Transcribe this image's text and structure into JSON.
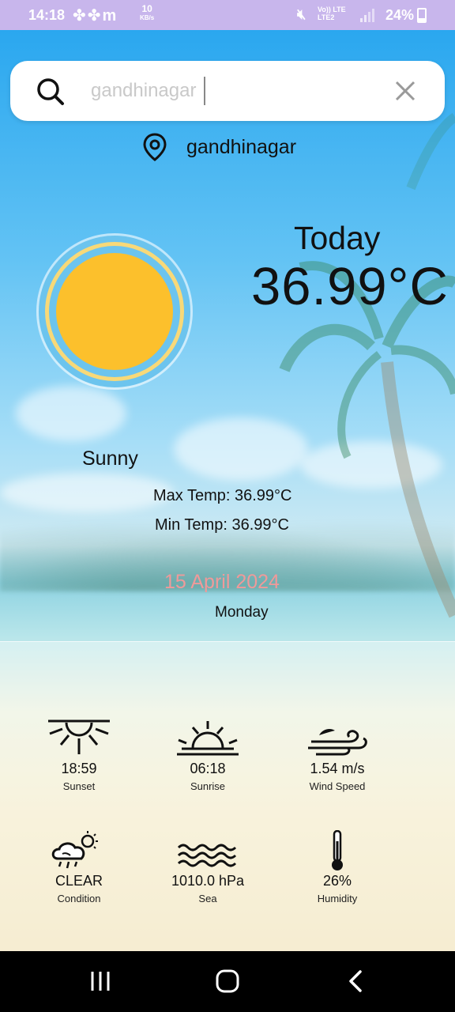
{
  "status_bar": {
    "time": "14:18",
    "data_speed": "10",
    "data_speed_unit": "KB/s",
    "network_1": "Vo)) LTE",
    "network_2": "LTE",
    "network_3": "LTE2",
    "battery": "24%"
  },
  "search": {
    "query": "gandhinagar",
    "placeholder": "gandhinagar"
  },
  "location": {
    "city": "gandhinagar"
  },
  "current": {
    "today_label": "Today",
    "temperature": "36.99°C",
    "condition": "Sunny",
    "max_temp": "Max Temp: 36.99°C",
    "min_temp": "Min Temp: 36.99°C",
    "date": "15 April 2024",
    "day": "Monday"
  },
  "stats": [
    {
      "value": "18:59",
      "label": "Sunset",
      "icon": "sunset-icon"
    },
    {
      "value": "06:18",
      "label": "Sunrise",
      "icon": "sunrise-icon"
    },
    {
      "value": "1.54 m/s",
      "label": "Wind Speed",
      "icon": "wind-icon"
    },
    {
      "value": "CLEAR",
      "label": "Condition",
      "icon": "weather-condition-icon"
    },
    {
      "value": "1010.0 hPa",
      "label": "Sea",
      "icon": "sea-waves-icon"
    },
    {
      "value": "26%",
      "label": "Humidity",
      "icon": "thermometer-icon"
    }
  ],
  "colors": {
    "sun": "#fcc02c",
    "sun_ring_blue": "#6cc4ee",
    "sun_ring_yellow": "#f8d978",
    "date_text": "#ef9a9a",
    "status_bar": "#c8b6ec"
  }
}
